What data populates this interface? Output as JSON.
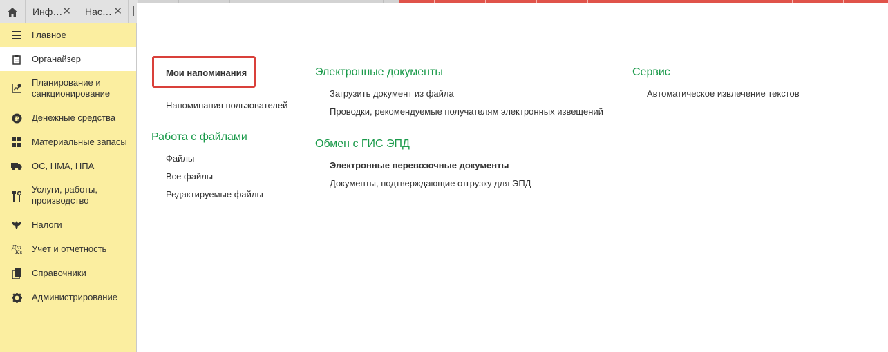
{
  "topbar": {
    "home_icon": "home-icon",
    "tabs": [
      {
        "label": "Инф…",
        "close": "✕"
      },
      {
        "label": "Нас…",
        "close": "✕"
      }
    ]
  },
  "sidebar": {
    "items": [
      {
        "label": "Главное",
        "icon": "menu-lines-icon"
      },
      {
        "label": "Органайзер",
        "icon": "clipboard-icon",
        "active": true
      },
      {
        "label": "Планирование и санкционирование",
        "icon": "planning-chart-icon"
      },
      {
        "label": "Денежные средства",
        "icon": "ruble-coin-icon"
      },
      {
        "label": "Материальные запасы",
        "icon": "grid-blocks-icon"
      },
      {
        "label": "ОС, НМА, НПА",
        "icon": "truck-icon"
      },
      {
        "label": "Услуги, работы, производство",
        "icon": "tools-icon"
      },
      {
        "label": "Налоги",
        "icon": "eagle-emblem-icon"
      },
      {
        "label": "Учет и отчетность",
        "icon": "debit-credit-icon"
      },
      {
        "label": "Справочники",
        "icon": "books-icon"
      },
      {
        "label": "Администрирование",
        "icon": "gear-icon"
      }
    ]
  },
  "main": {
    "col1": {
      "highlighted_link": "Мои напоминания",
      "links_top": [
        "Напоминания пользователей"
      ],
      "files_title": "Работа с файлами",
      "files_links": [
        "Файлы",
        "Все файлы",
        "Редактируемые файлы"
      ]
    },
    "col2": {
      "edoc_title": "Электронные документы",
      "edoc_links": [
        "Загрузить документ из файла",
        "Проводки, рекомендуемые получателям электронных извещений"
      ],
      "gis_title": "Обмен с ГИС ЭПД",
      "gis_links": [
        "Электронные перевозочные документы",
        "Документы, подтверждающие отгрузку для ЭПД"
      ]
    },
    "col3": {
      "service_title": "Сервис",
      "service_links": [
        "Автоматическое извлечение текстов"
      ]
    }
  },
  "colors": {
    "sidebar_bg": "#fbeea0",
    "section_title": "#1a9a4a",
    "highlight_border": "#d9403a"
  }
}
